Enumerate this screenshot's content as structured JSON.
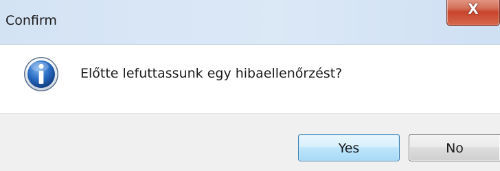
{
  "window": {
    "title": "Confirm",
    "close_glyph": "X"
  },
  "message": {
    "icon": "info-icon",
    "text": "Előtte lefuttassunk egy hibaellenőrzést?"
  },
  "buttons": {
    "yes_label": "Yes",
    "no_label": "No"
  },
  "colors": {
    "info_icon_blue": "#1f5fb5",
    "close_button_red": "#c7442c",
    "default_button_border": "#3c7fb1"
  }
}
